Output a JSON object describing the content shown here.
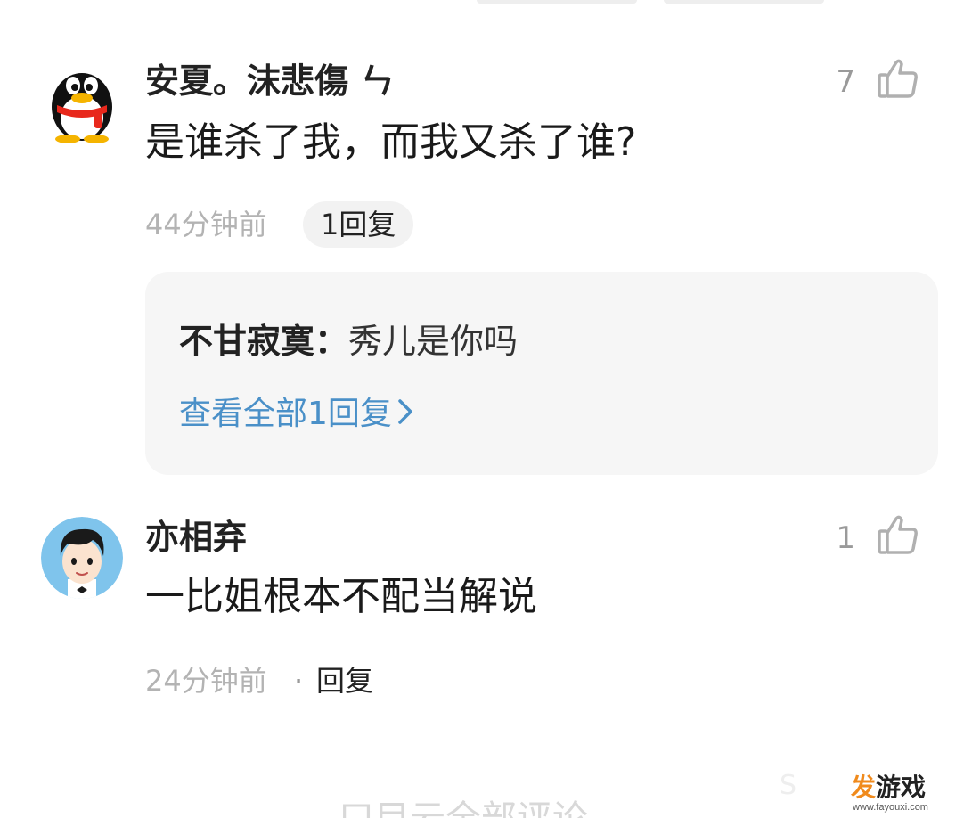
{
  "comments": [
    {
      "username": "安夏。沫悲傷 ㄣ",
      "text": "是谁杀了我，而我又杀了谁?",
      "time": "44分钟前",
      "likes": "7",
      "avatar_icon": "qq-penguin-icon",
      "reply_pill": "1回复",
      "reply_preview": {
        "author": "不甘寂寞",
        "colon": "：",
        "text": "秀儿是你吗",
        "view_all": "查看全部1回复"
      }
    },
    {
      "username": "亦相弃",
      "text": "一比姐根本不配当解说",
      "time": "24分钟前",
      "likes": "1",
      "avatar_icon": "cartoon-boy-icon",
      "separator": "·",
      "reply_link": "回复"
    }
  ],
  "footer": {
    "faded_text": "口目云全部评论"
  },
  "watermark": {
    "logo_first": "发",
    "logo_rest": "游戏",
    "url": "www.fayouxi.com",
    "ghost_text": "S"
  },
  "colors": {
    "link_blue": "#4a90c8",
    "meta_gray": "#b3b3b3",
    "bubble_bg": "#f6f6f6",
    "watermark_orange": "#f08a1c"
  }
}
